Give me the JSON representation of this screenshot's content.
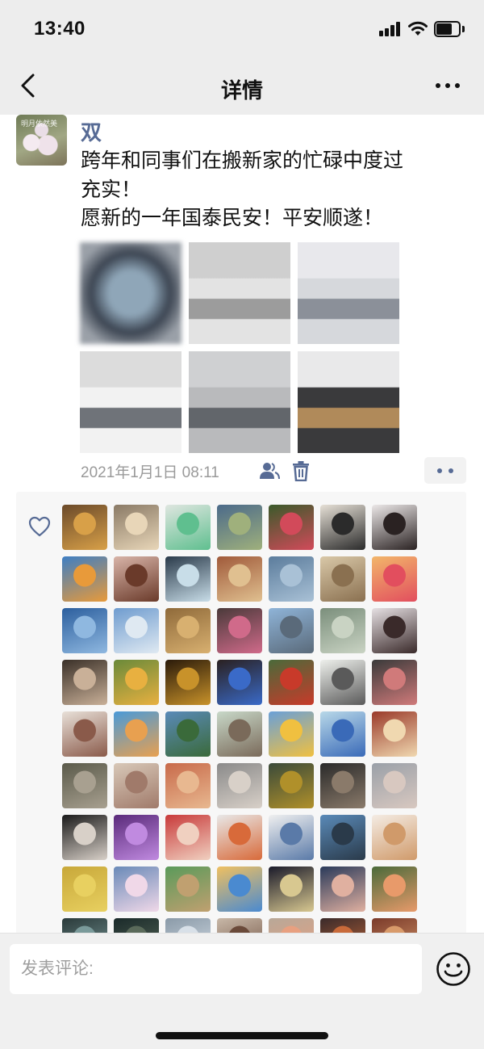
{
  "status": {
    "time": "13:40",
    "battery_level": 0.7
  },
  "nav": {
    "title": "详情",
    "back_icon": "chevron-left-icon",
    "more_icon": "more-icon"
  },
  "post": {
    "author": "双",
    "avatar_text": "明月依然美",
    "text_lines": [
      "跨年和同事们在搬新家的忙碌中度过",
      "充实！",
      "愿新的一年国泰民安！平安顺遂！"
    ],
    "photos": [
      {
        "name": "blurred-photo",
        "colors": [
          "#3c4552",
          "#8fa6b8",
          "#c7d2da"
        ]
      },
      {
        "name": "empty-office-floor",
        "colors": [
          "#cfcfcf",
          "#9c9c9c",
          "#e3e3e3"
        ]
      },
      {
        "name": "office-ceiling-lights",
        "colors": [
          "#e8e8ec",
          "#8b9099",
          "#d6d8dc"
        ]
      },
      {
        "name": "office-column",
        "colors": [
          "#dcdcdc",
          "#6f7379",
          "#f2f2f2"
        ]
      },
      {
        "name": "office-desks",
        "colors": [
          "#cfd0d2",
          "#62666b",
          "#b9babc"
        ]
      },
      {
        "name": "office-wood-desk",
        "colors": [
          "#e9e9ea",
          "#b08a5a",
          "#3a3a3c"
        ]
      }
    ],
    "timestamp": "2021年1月1日 08:11",
    "privacy_icon": "people-icon",
    "delete_icon": "trash-icon",
    "action_icon": "more-dots-icon"
  },
  "likes": {
    "heart_icon": "heart-icon",
    "avatars": [
      [
        "#6b4a2a",
        "#d8a048"
      ],
      [
        "#8a7a66",
        "#e8d6b8"
      ],
      [
        "#dfe6e0",
        "#5fbf8f"
      ],
      [
        "#4b6a8a",
        "#9fb07c"
      ],
      [
        "#3a5a2a",
        "#d24a5a"
      ],
      [
        "#e6e0d6",
        "#2b2b2b"
      ],
      [
        "#ece8e8",
        "#2a2222"
      ],
      [
        "#3d7ec4",
        "#e89a3a"
      ],
      [
        "#d8b4a8",
        "#6a3a2a"
      ],
      [
        "#2a3a4a",
        "#c8dde8"
      ],
      [
        "#a05a3a",
        "#e0c090"
      ],
      [
        "#5b7c9c",
        "#a9c1d6"
      ],
      [
        "#d9c8a8",
        "#8a7050"
      ],
      [
        "#f2b66a",
        "#e24e5e"
      ],
      [
        "#2c5f9e",
        "#8fb8e0"
      ],
      [
        "#6f9ccf",
        "#dfe9f2"
      ],
      [
        "#8f6a3a",
        "#d8b070"
      ],
      [
        "#4a3a3a",
        "#d06a8a"
      ],
      [
        "#8fb4d8",
        "#5a6a7a"
      ],
      [
        "#7b8f7c",
        "#c9d3c3"
      ],
      [
        "#e6e0e3",
        "#3a2a2a"
      ],
      [
        "#3a3028",
        "#c9b098"
      ],
      [
        "#6a8a3a",
        "#e8b040"
      ],
      [
        "#2a1a0a",
        "#c8922a"
      ],
      [
        "#2a2020",
        "#3a6ac8"
      ],
      [
        "#4a6a3a",
        "#c83a2a"
      ],
      [
        "#eef0ec",
        "#5a5a5a"
      ],
      [
        "#3a3a3a",
        "#d07a7a"
      ],
      [
        "#e8e0d8",
        "#8a5a4a"
      ],
      [
        "#4a9ad8",
        "#e8a050"
      ],
      [
        "#5a8ab8",
        "#3a6a3a"
      ],
      [
        "#c8d8c8",
        "#7a6a5a"
      ],
      [
        "#6aa0d8",
        "#f0c040"
      ],
      [
        "#b8d8e8",
        "#3a6ab8"
      ],
      [
        "#9a3a2a",
        "#f0d8b0"
      ],
      [
        "#5a5a4a",
        "#a8a090"
      ],
      [
        "#d8c8b8",
        "#a07a6a"
      ],
      [
        "#c86a4a",
        "#e8b890"
      ],
      [
        "#8a8a8a",
        "#d8d0c8"
      ],
      [
        "#3a4a3a",
        "#b0902a"
      ],
      [
        "#2a2a2a",
        "#8a7a6a"
      ],
      [
        "#9aa0a8",
        "#d8c8c0"
      ],
      [
        "#1a1a1a",
        "#d8d0c8"
      ],
      [
        "#5a2a7a",
        "#c08ae0"
      ],
      [
        "#c83a3a",
        "#f0d0c0"
      ],
      [
        "#e8e8e8",
        "#d86a3a"
      ],
      [
        "#f0f0f0",
        "#5a7aa8"
      ],
      [
        "#5a8ab8",
        "#2a3a4a"
      ],
      [
        "#f4ece4",
        "#d09a6a"
      ],
      [
        "#c8a83a",
        "#e8d060"
      ],
      [
        "#6a8ab8",
        "#f0d8e8"
      ],
      [
        "#5a9a5a",
        "#c0a070"
      ],
      [
        "#f0c060",
        "#4a8ad0"
      ],
      [
        "#1a1a2a",
        "#d8c890"
      ],
      [
        "#2a3a5a",
        "#e0b0a0"
      ],
      [
        "#4a6a3a",
        "#e89a6a"
      ],
      [
        "#2a3a3a",
        "#7a9a9a"
      ],
      [
        "#1a2a2a",
        "#5a6a5a"
      ],
      [
        "#8a9aa8",
        "#d8e0e8"
      ],
      [
        "#c8b8a8",
        "#6a4a3a"
      ],
      [
        "#b8a898",
        "#e8a080"
      ],
      [
        "#3a2a2a",
        "#c86a3a"
      ],
      [
        "#7a3a2a",
        "#d89a6a"
      ]
    ]
  },
  "comment": {
    "placeholder": "发表评论:",
    "emoji_icon": "emoji-icon"
  }
}
